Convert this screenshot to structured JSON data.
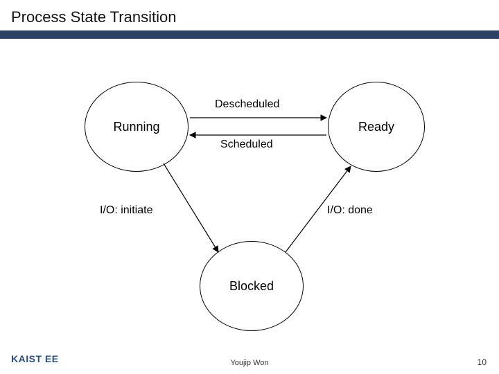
{
  "header": {
    "title": "Process State Transition",
    "band_color": "#2b4265"
  },
  "states": {
    "running": "Running",
    "ready": "Ready",
    "blocked": "Blocked"
  },
  "transitions": {
    "descheduled": "Descheduled",
    "scheduled": "Scheduled",
    "io_initiate": "I/O: initiate",
    "io_done": "I/O: done"
  },
  "footer": {
    "logo_text": "KAIST EE",
    "author": "Youjip Won",
    "page": "10"
  },
  "chart_data": {
    "type": "diagram",
    "title": "Process State Transition",
    "nodes": [
      {
        "id": "running",
        "label": "Running"
      },
      {
        "id": "ready",
        "label": "Ready"
      },
      {
        "id": "blocked",
        "label": "Blocked"
      }
    ],
    "edges": [
      {
        "from": "running",
        "to": "ready",
        "label": "Descheduled"
      },
      {
        "from": "ready",
        "to": "running",
        "label": "Scheduled"
      },
      {
        "from": "running",
        "to": "blocked",
        "label": "I/O: initiate"
      },
      {
        "from": "blocked",
        "to": "ready",
        "label": "I/O: done"
      }
    ]
  }
}
